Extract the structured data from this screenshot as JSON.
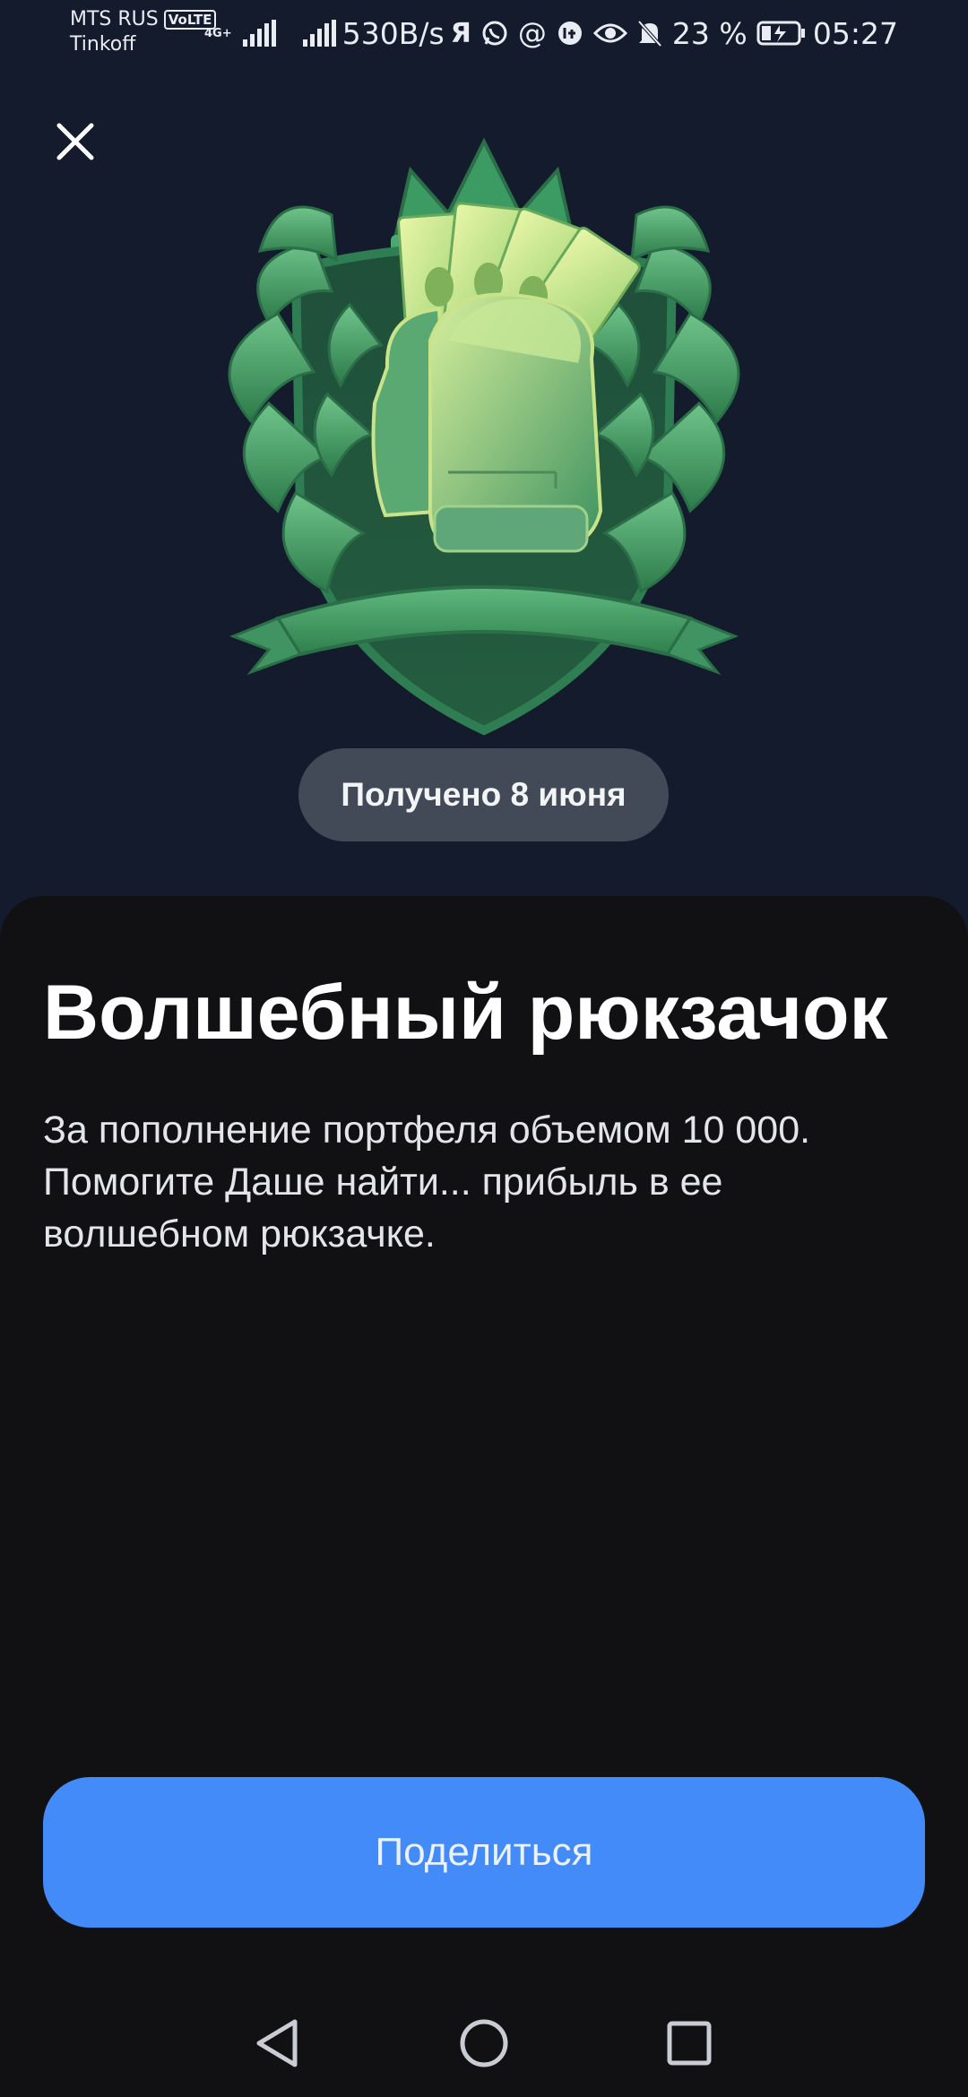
{
  "status_bar": {
    "carrier": "MTS RUS",
    "volte": "VoLTE",
    "network_type": "4G+",
    "app_label": "Tinkoff",
    "speed": "530B/s",
    "yandex_glyph": "Я",
    "battery_percent": "23 %",
    "time": "05:27",
    "icons": [
      "signal-icon",
      "signal-icon",
      "yandex-icon",
      "whatsapp-icon",
      "at-sign-icon",
      "notification-badge-icon",
      "eye-icon",
      "bell-muted-icon",
      "battery-charging-icon"
    ]
  },
  "close_icon": "close-icon",
  "badge": {
    "image": "magic-backpack-badge",
    "received_label": "Получено 8 июня"
  },
  "sheet": {
    "title": "Волшебный рюкзачок",
    "description": "За пополнение портфеля объемом 10 000. Помогите Даше найти... прибыль в ее волшебном рюкзачке.",
    "share_button_label": "Поделиться"
  },
  "nav_bar": {
    "icons": [
      "back-icon",
      "home-icon",
      "recents-icon"
    ]
  },
  "colors": {
    "background": "#141b2d",
    "sheet_background": "#111113",
    "pill_background": "#424a57",
    "accent_button": "#428bf9"
  }
}
